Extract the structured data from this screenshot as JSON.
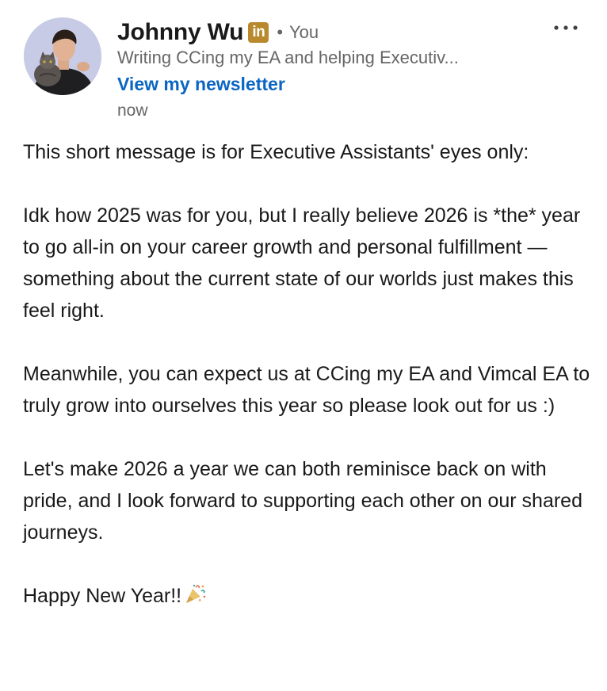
{
  "author": {
    "name": "Johnny Wu",
    "badge_text": "in",
    "badge_icon": "linkedin-premium-badge-icon",
    "separator": "•",
    "degree": "You",
    "headline": "Writing CCing my EA and helping Executiv...",
    "newsletter_link": "View my newsletter",
    "timestamp": "now"
  },
  "more_menu_icon": "more-options-icon",
  "post": {
    "paragraphs": [
      "This short message is for Executive Assistants' eyes only:",
      "Idk how 2025 was for you, but I really believe 2026 is *the* year to go all-in on your career growth and personal fulfillment — something about the current state of our worlds just makes this feel right.",
      "Meanwhile, you can expect us at CCing my EA and Vimcal EA to truly grow into ourselves this year so please look out for us :)",
      "Let's make 2026 a year we can both reminisce back on with pride, and I look forward to supporting each other on our shared journeys."
    ],
    "closing": "Happy New Year!!",
    "closing_icon": "party-popper-icon"
  },
  "colors": {
    "text": "#191919",
    "secondary_text": "#666666",
    "link": "#0a66c2",
    "badge": "#b88a2d"
  }
}
